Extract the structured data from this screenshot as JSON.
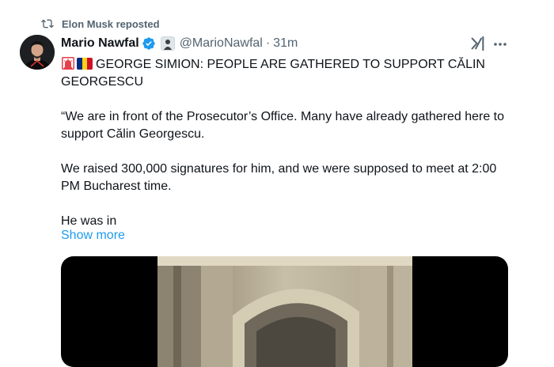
{
  "repost": {
    "text": "Elon Musk reposted",
    "icon": "repost-icon"
  },
  "author": {
    "name": "Mario Nawfal",
    "handle": "@MarioNawfal",
    "separator": "·",
    "time": "31m",
    "verified_color": "#1d9bf0"
  },
  "tweet": {
    "headline": "GEORGE SIMION: PEOPLE ARE GATHERED TO SUPPORT CĂLIN GEORGESCU",
    "paragraph_1": "“We are in front of the Prosecutor’s Office. Many have already gathered here to support Călin Georgescu.",
    "paragraph_2": "We raised 300,000 signatures for him, and we were supposed to meet at 2:00 PM Bucharest time.",
    "paragraph_3": "He was in",
    "show_more": "Show more",
    "emojis": [
      "siren-icon",
      "romania-flag-icon"
    ]
  },
  "colors": {
    "accent": "#1d9bf0",
    "secondary_text": "#536471",
    "primary_text": "#0f1419",
    "flag_blue": "#002b7f",
    "flag_yellow": "#fcd116",
    "flag_red": "#ce1126"
  }
}
